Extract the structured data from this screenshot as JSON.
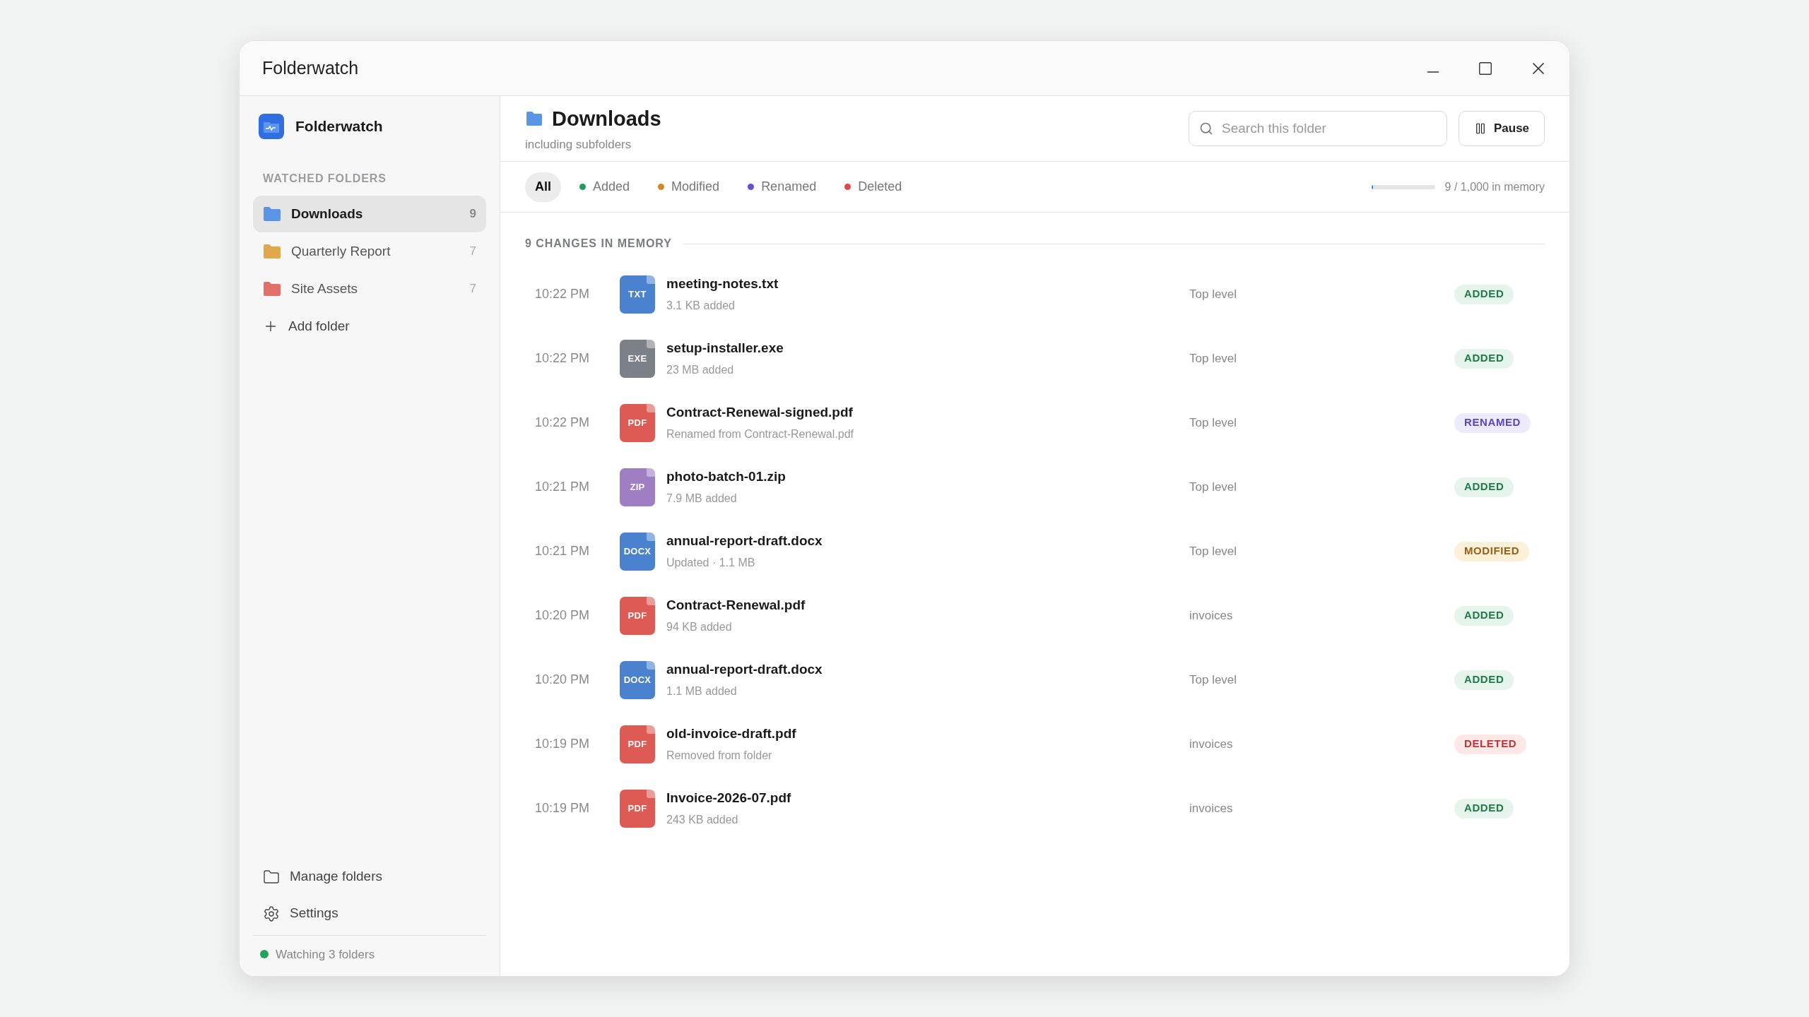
{
  "window": {
    "title": "Folderwatch"
  },
  "sidebar": {
    "app_name": "Folderwatch",
    "section_title": "WATCHED FOLDERS",
    "folders": [
      {
        "name": "Downloads",
        "count": "9",
        "color": "#5b95e6",
        "selected": true
      },
      {
        "name": "Quarterly Report",
        "count": "7",
        "color": "#dfa84a",
        "selected": false
      },
      {
        "name": "Site Assets",
        "count": "7",
        "color": "#e36f6a",
        "selected": false
      }
    ],
    "add_folder": "Add folder",
    "footer_items": [
      {
        "kind": "folder",
        "label": "Manage folders"
      },
      {
        "kind": "settings",
        "label": "Settings"
      }
    ],
    "status": {
      "text": "Watching 3 folders",
      "on": true
    }
  },
  "header": {
    "title": "Downloads",
    "subtitle": "including subfolders",
    "search": {
      "placeholder": "Search this folder"
    },
    "pause_button": "Pause"
  },
  "filters": [
    {
      "label": "All",
      "selected": true
    },
    {
      "label": "Added",
      "selected": false,
      "color": "#239a5b"
    },
    {
      "label": "Modified",
      "selected": false,
      "color": "#d1862a"
    },
    {
      "label": "Renamed",
      "selected": false,
      "color": "#6750c8"
    },
    {
      "label": "Deleted",
      "selected": false,
      "color": "#e04848"
    }
  ],
  "memory": {
    "level": 0.03,
    "reading": "9 / 1,000 in memory"
  },
  "list": {
    "title": "9 CHANGES IN MEMORY",
    "rows": [
      {
        "time": "10:22 PM",
        "color": "#4a82cf",
        "icon_label": "TXT",
        "name": "meeting-notes.txt",
        "detail": "3.1 KB added",
        "location": "Top level",
        "kind": "added",
        "badge": "ADDED"
      },
      {
        "time": "10:22 PM",
        "color": "#7c8088",
        "icon_label": "EXE",
        "name": "setup-installer.exe",
        "detail": "23 MB added",
        "location": "Top level",
        "kind": "added",
        "badge": "ADDED"
      },
      {
        "time": "10:22 PM",
        "color": "#de5a55",
        "icon_label": "PDF",
        "name": "Contract-Renewal-signed.pdf",
        "detail": "Renamed from Contract-Renewal.pdf",
        "location": "Top level",
        "kind": "renamed",
        "badge": "RENAMED"
      },
      {
        "time": "10:21 PM",
        "color": "#a07ec4",
        "icon_label": "ZIP",
        "name": "photo-batch-01.zip",
        "detail": "7.9 MB added",
        "location": "Top level",
        "kind": "added",
        "badge": "ADDED"
      },
      {
        "time": "10:21 PM",
        "color": "#4a82cf",
        "icon_label": "DOCX",
        "name": "annual-report-draft.docx",
        "detail": "Updated · 1.1 MB",
        "location": "Top level",
        "kind": "modified",
        "badge": "MODIFIED"
      },
      {
        "time": "10:20 PM",
        "color": "#de5a55",
        "icon_label": "PDF",
        "name": "Contract-Renewal.pdf",
        "detail": "94 KB added",
        "location": "invoices",
        "kind": "added",
        "badge": "ADDED"
      },
      {
        "time": "10:20 PM",
        "color": "#4a82cf",
        "icon_label": "DOCX",
        "name": "annual-report-draft.docx",
        "detail": "1.1 MB added",
        "location": "Top level",
        "kind": "added",
        "badge": "ADDED"
      },
      {
        "time": "10:19 PM",
        "color": "#de5a55",
        "icon_label": "PDF",
        "name": "old-invoice-draft.pdf",
        "detail": "Removed from folder",
        "location": "invoices",
        "kind": "deleted",
        "badge": "DELETED"
      },
      {
        "time": "10:19 PM",
        "color": "#de5a55",
        "icon_label": "PDF",
        "name": "Invoice-2026-07.pdf",
        "detail": "243 KB added",
        "location": "invoices",
        "kind": "added",
        "badge": "ADDED"
      }
    ]
  }
}
